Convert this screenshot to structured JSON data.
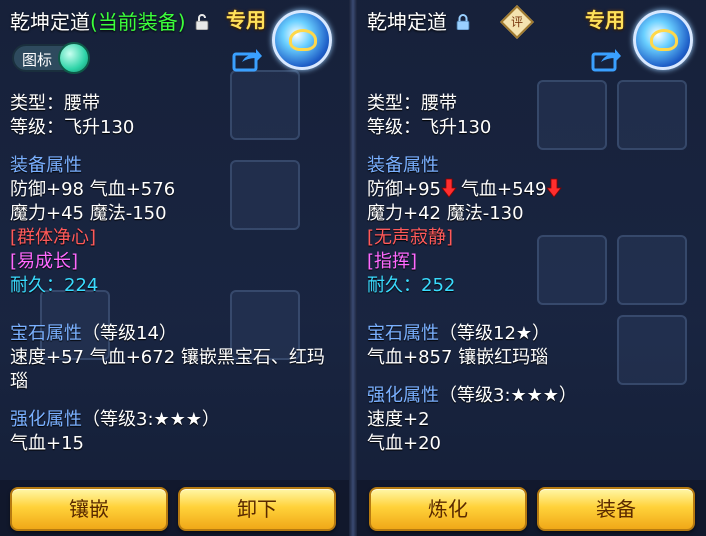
{
  "left": {
    "title": "乾坤定道",
    "title_status": "(当前装备)",
    "lock_state": "unlocked",
    "tag": "专用",
    "toggle_label": "图标",
    "toggle_on": true,
    "type_line": "类型：腰带",
    "level_line": "等级：飞升130",
    "attr_header": "装备属性",
    "attr_line1": "防御+98 气血+576",
    "attr_line2": "魔力+45 魔法-150",
    "special1": "[群体净心]",
    "special2": "[易成长]",
    "durability": "耐久：224",
    "gem_header": "宝石属性",
    "gem_level": "（等级14）",
    "gem_line": "速度+57 气血+672 镶嵌黑宝石、红玛瑙",
    "enh_header": "强化属性",
    "enh_level": "（等级3:★★★）",
    "enh_line1": "气血+15",
    "btn1": "镶嵌",
    "btn2": "卸下"
  },
  "right": {
    "title": "乾坤定道",
    "lock_state": "locked",
    "ping": "评",
    "tag": "专用",
    "type_line": "类型：腰带",
    "level_line": "等级：飞升130",
    "attr_header": "装备属性",
    "def": "防御+95",
    "hp": "气血+549",
    "attr_line2": "魔力+42 魔法-130",
    "special1": "[无声寂静]",
    "special2": "[指挥]",
    "durability": "耐久：252",
    "gem_header": "宝石属性",
    "gem_level": "（等级12★）",
    "gem_line": "气血+857 镶嵌红玛瑙",
    "enh_header": "强化属性",
    "enh_level": "（等级3:★★★）",
    "enh_line1": "速度+2",
    "enh_line2": "气血+20",
    "btn1": "炼化",
    "btn2": "装备"
  },
  "colors": {
    "section": "#7ab0ff",
    "special_red": "#ff5a5a",
    "special_purple": "#ff6aff",
    "durability": "#3adcff",
    "current_green": "#3cff3c",
    "tag_gold": "#ffe15a"
  },
  "icons": [
    "unlock-icon",
    "lock-icon",
    "share-icon",
    "badge-icon",
    "toggle-knob",
    "arrow-down-icon"
  ]
}
